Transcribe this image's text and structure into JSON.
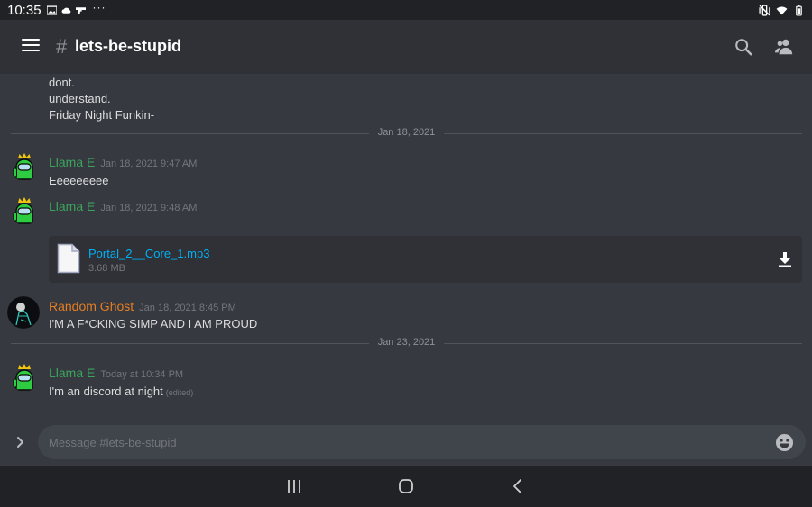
{
  "status_bar": {
    "time": "10:35",
    "left_icons": [
      "image-icon",
      "cloud-icon",
      "gun-icon"
    ],
    "more": "···",
    "right_icons": [
      "mute-vibrate-icon",
      "wifi-icon",
      "battery-icon"
    ]
  },
  "header": {
    "hash": "#",
    "channel": "lets-be-stupid",
    "icons": [
      "menu-icon",
      "search-icon",
      "members-icon"
    ]
  },
  "messages": {
    "prev_lines": [
      "dont.",
      "understand.",
      "Friday Night Funkin-"
    ],
    "date_dividers": [
      "Jan 18, 2021",
      "Jan 23, 2021"
    ],
    "groups": [
      {
        "author": "Llama E",
        "timestamp": "Jan 18, 2021 9:47 AM",
        "text": "Eeeeeeeee"
      },
      {
        "author": "Llama E",
        "timestamp": "Jan 18, 2021 9:48 AM",
        "text": ""
      },
      {
        "author": "Random Ghost",
        "timestamp": "Jan 18, 2021 8:45 PM",
        "text": "I'M A F*CKING SIMP AND I AM PROUD"
      },
      {
        "author": "Llama E",
        "timestamp": "Today at 10:34 PM",
        "text": "I'm an discord at night",
        "edited": "(edited)"
      }
    ],
    "attachment": {
      "filename": "Portal_2__Core_1.mp3",
      "size": "3.68 MB"
    }
  },
  "composer": {
    "placeholder": "Message #lets-be-stupid"
  },
  "colors": {
    "background": "#36393f",
    "header": "#2f3136",
    "llama_name": "#3ba55d",
    "ghost_name": "#e67e22",
    "link": "#00b0f4",
    "system_bar": "#202225"
  }
}
